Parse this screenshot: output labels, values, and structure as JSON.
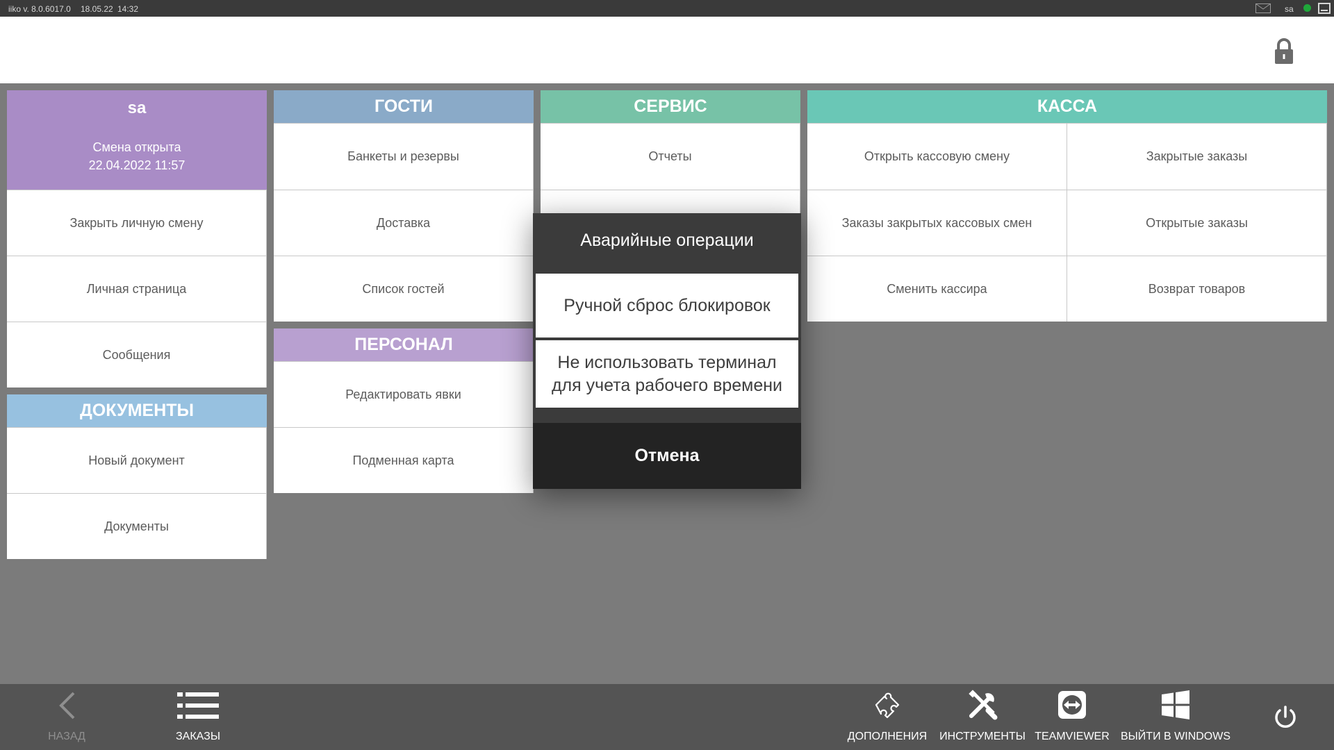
{
  "status_bar": {
    "version": "iiko  v. 8.0.6017.0",
    "date": "18.05.22",
    "time": "14:32",
    "user": "sa"
  },
  "colors": {
    "user_card": "#a98cc6",
    "guests_header": "#8aaac8",
    "service_header": "#77c2a7",
    "cash_header": "#6ac7b6",
    "staff_header": "#b8a0d0",
    "documents_header": "#97c1e0",
    "status_online": "#1fa83a"
  },
  "user_card": {
    "name": "sa",
    "shift_status": "Смена открыта",
    "shift_time": "22.04.2022 11:57"
  },
  "user_menu": [
    "Закрыть личную смену",
    "Личная страница",
    "Сообщения"
  ],
  "documents": {
    "title": "ДОКУМЕНТЫ",
    "items": [
      "Новый документ",
      "Документы"
    ]
  },
  "guests": {
    "title": "ГОСТИ",
    "items": [
      "Банкеты и резервы",
      "Доставка",
      "Список гостей"
    ]
  },
  "staff": {
    "title": "ПЕРСОНАЛ",
    "items": [
      "Редактировать явки",
      "Подменная карта"
    ]
  },
  "service": {
    "title": "СЕРВИС",
    "items": [
      "Отчеты"
    ]
  },
  "cash": {
    "title": "КАССА",
    "items": [
      "Открыть кассовую смену",
      "Закрытые заказы",
      "Заказы закрытых кассовых смен",
      "Открытые заказы",
      "Сменить кассира",
      "Возврат товаров"
    ]
  },
  "modal": {
    "title": "Аварийные операции",
    "option1": "Ручной сброс блокировок",
    "option2_line1": "Не использовать терминал",
    "option2_line2": "для учета рабочего времени",
    "cancel": "Отмена"
  },
  "bottom_bar": {
    "back": "НАЗАД",
    "orders": "ЗАКАЗЫ",
    "addons": "ДОПОЛНЕНИЯ",
    "tools": "ИНСТРУМЕНТЫ",
    "teamviewer": "TEAMVIEWER",
    "exit_windows": "ВЫЙТИ В WINDOWS"
  },
  "icons": {
    "mail": "mail-icon",
    "lock": "lock-icon",
    "back": "chevron-left-icon",
    "orders": "list-icon",
    "addons": "puzzle-icon",
    "tools": "wrench-screwdriver-icon",
    "teamviewer": "teamviewer-icon",
    "windows": "windows-logo-icon",
    "power": "power-icon"
  }
}
